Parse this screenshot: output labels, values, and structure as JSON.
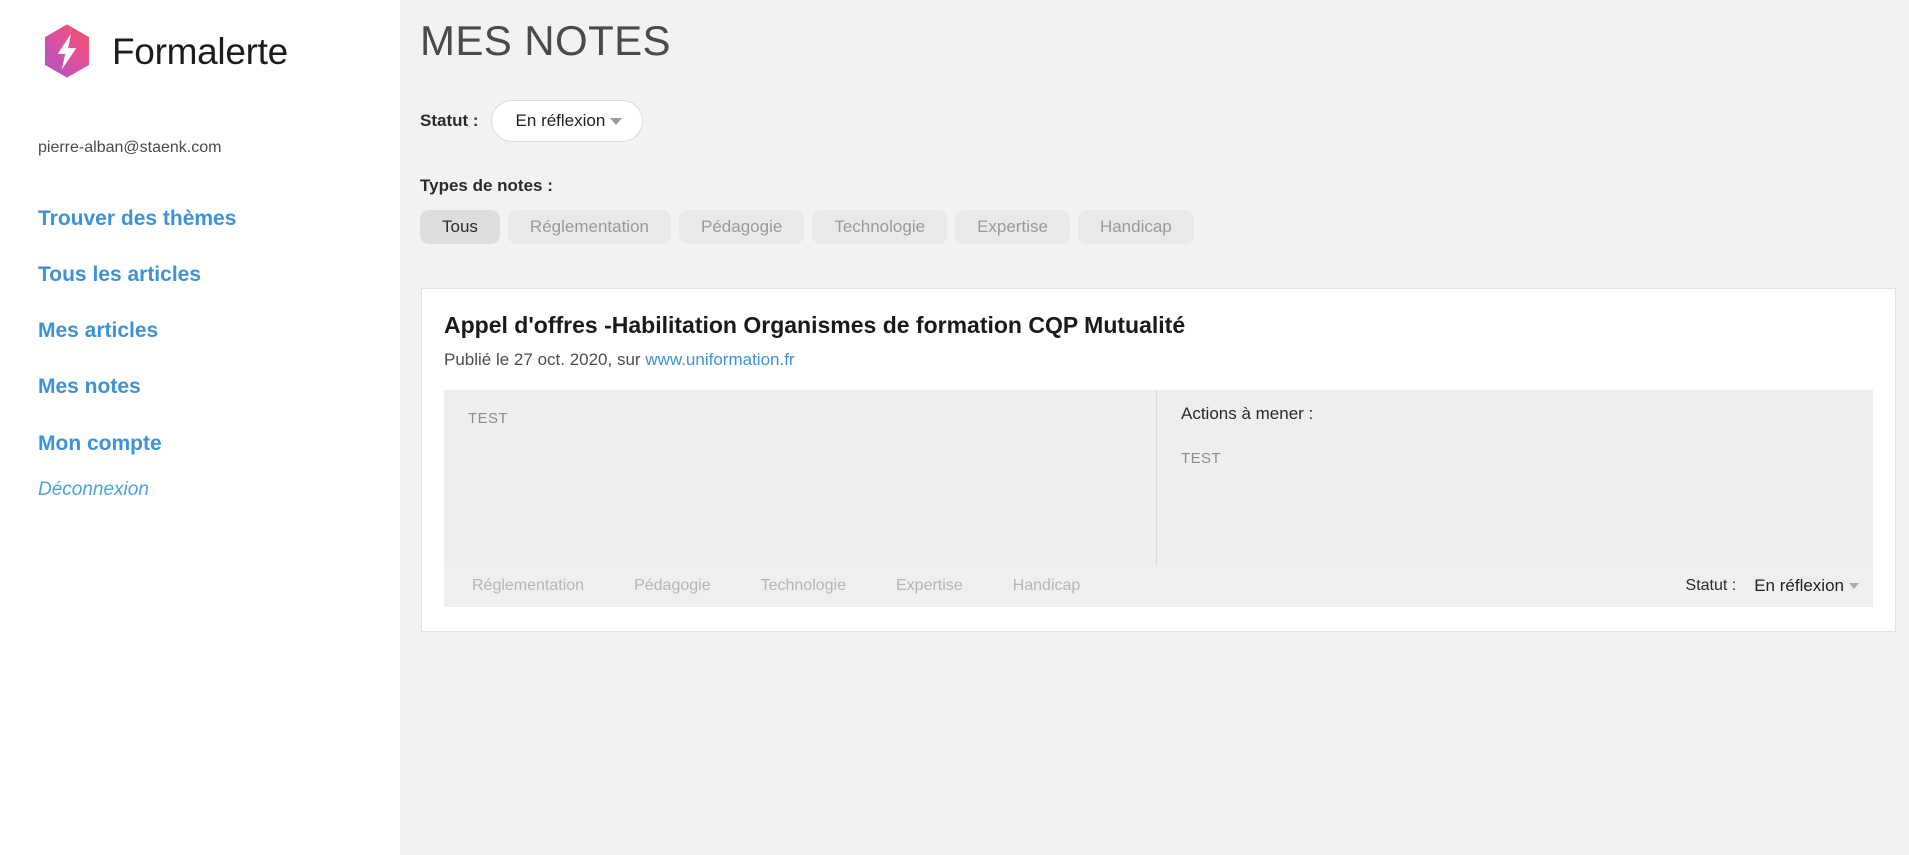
{
  "brand": {
    "name": "Formalerte",
    "logo_icon": "hexagon-lightning-bolt-icon",
    "logo_gradient_from": "#a855c8",
    "logo_gradient_to": "#f2545b"
  },
  "sidebar": {
    "user_email": "pierre-alban@staenk.com",
    "nav": [
      {
        "label": "Trouver des thèmes",
        "name": "find-themes"
      },
      {
        "label": "Tous les articles",
        "name": "all-articles"
      },
      {
        "label": "Mes articles",
        "name": "my-articles"
      },
      {
        "label": "Mes notes",
        "name": "my-notes"
      },
      {
        "label": "Mon compte",
        "name": "my-account"
      }
    ],
    "logout_label": "Déconnexion",
    "link_color": "#3d93d8"
  },
  "main": {
    "page_title": "MES NOTES",
    "status_filter": {
      "label": "Statut :",
      "value": "En réflexion",
      "caret_icon": "chevron-down-icon"
    },
    "types_filter": {
      "label": "Types de notes :",
      "chips": [
        {
          "label": "Tous",
          "active": true
        },
        {
          "label": "Réglementation",
          "active": false
        },
        {
          "label": "Pédagogie",
          "active": false
        },
        {
          "label": "Technologie",
          "active": false
        },
        {
          "label": "Expertise",
          "active": false
        },
        {
          "label": "Handicap",
          "active": false
        }
      ]
    }
  },
  "note_card": {
    "title": "Appel d'offres -Habilitation Organismes de formation CQP Mutualité",
    "meta_prefix": "Publié le 27 oct. 2020, sur",
    "source_link": "www.uniformation.fr",
    "note_text": "TEST",
    "actions_heading": "Actions à mener :",
    "actions_text": "TEST",
    "tags": [
      "Réglementation",
      "Pédagogie",
      "Technologie",
      "Expertise",
      "Handicap"
    ],
    "footer_status": {
      "label": "Statut :",
      "value": "En réflexion",
      "caret_icon": "chevron-down-icon"
    }
  }
}
